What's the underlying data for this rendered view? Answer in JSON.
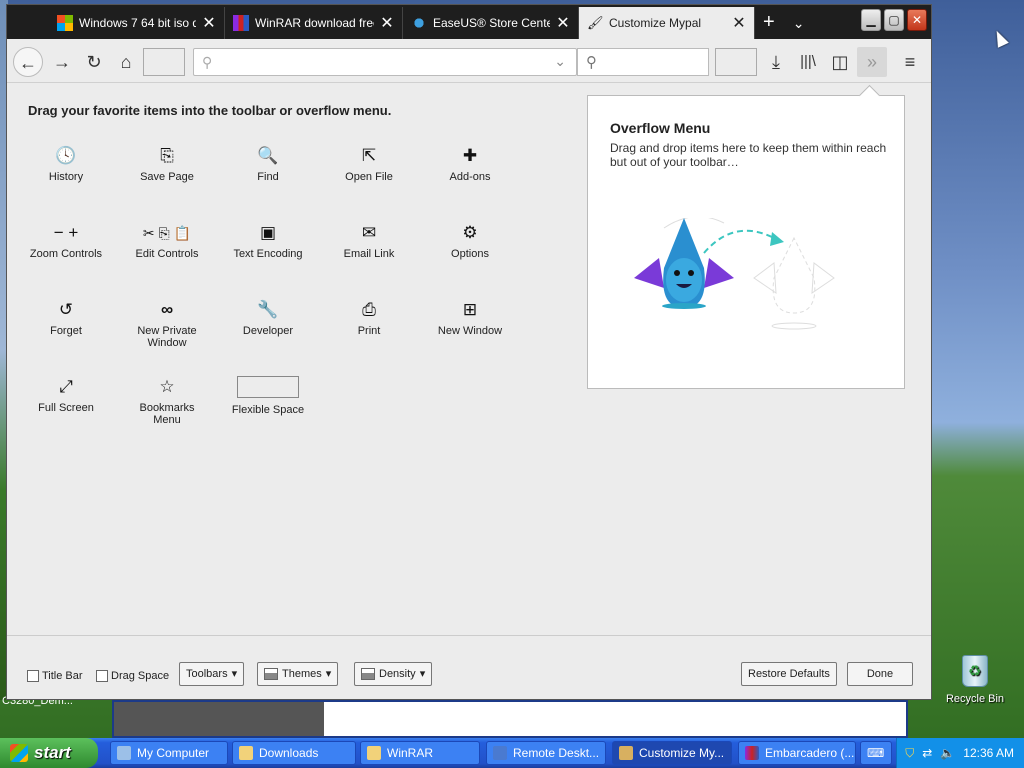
{
  "tabs": [
    {
      "label": "Windows 7 64 bit iso do",
      "icon": "microsoft-icon"
    },
    {
      "label": "WinRAR download free a",
      "icon": "winrar-icon"
    },
    {
      "label": "EaseUS® Store Center",
      "icon": "easeus-icon"
    },
    {
      "label": "Customize Mypal",
      "icon": "paintbrush-icon",
      "active": true
    }
  ],
  "tab_close": "✕",
  "heading": "Drag your favorite items into the toolbar or overflow menu.",
  "items": [
    {
      "label": "History",
      "icon": "clock-icon",
      "glyph": "🕓"
    },
    {
      "label": "Save Page",
      "icon": "save-page-icon",
      "glyph": "⎘"
    },
    {
      "label": "Find",
      "icon": "search-icon",
      "glyph": "🔍"
    },
    {
      "label": "Open File",
      "icon": "open-file-icon",
      "glyph": "⇱"
    },
    {
      "label": "Add-ons",
      "icon": "puzzle-icon",
      "glyph": "✚"
    },
    {
      "label": "Zoom Controls",
      "icon": "zoom-icon",
      "glyph": "− +"
    },
    {
      "label": "Edit Controls",
      "icon": "edit-icon",
      "glyph": "✂ ⎘ 📋"
    },
    {
      "label": "Text Encoding",
      "icon": "text-encoding-icon",
      "glyph": "▣"
    },
    {
      "label": "Email Link",
      "icon": "email-icon",
      "glyph": "✉"
    },
    {
      "label": "Options",
      "icon": "gear-icon",
      "glyph": "⚙"
    },
    {
      "label": "Forget",
      "icon": "forget-icon",
      "glyph": "↺"
    },
    {
      "label": "New Private Window",
      "icon": "mask-icon",
      "glyph": "∞"
    },
    {
      "label": "Developer",
      "icon": "wrench-icon",
      "glyph": "🔧"
    },
    {
      "label": "Print",
      "icon": "printer-icon",
      "glyph": "⎙"
    },
    {
      "label": "New Window",
      "icon": "new-window-icon",
      "glyph": "⊞"
    },
    {
      "label": "Full Screen",
      "icon": "fullscreen-icon",
      "glyph": "⤢"
    },
    {
      "label": "Bookmarks Menu",
      "icon": "bookmark-star-icon",
      "glyph": "☆"
    },
    {
      "label": "Flexible Space",
      "icon": "flexible-space",
      "glyph": ""
    }
  ],
  "overflow": {
    "title": "Overflow Menu",
    "description": "Drag and drop items here to keep them within reach but out of your toolbar…"
  },
  "footer": {
    "title_bar": "Title Bar",
    "drag_space": "Drag Space",
    "toolbars": "Toolbars",
    "themes": "Themes",
    "density": "Density",
    "restore": "Restore Defaults",
    "done": "Done"
  },
  "desktop": {
    "recycle_bin": "Recycle Bin",
    "partial_label": "C3280_Dem..."
  },
  "taskbar": {
    "start": "start",
    "tasks": [
      "My Computer",
      "Downloads",
      "WinRAR",
      "Remote Deskt...",
      "Customize My...",
      "Embarcadero (..."
    ],
    "clock": "12:36 AM"
  }
}
